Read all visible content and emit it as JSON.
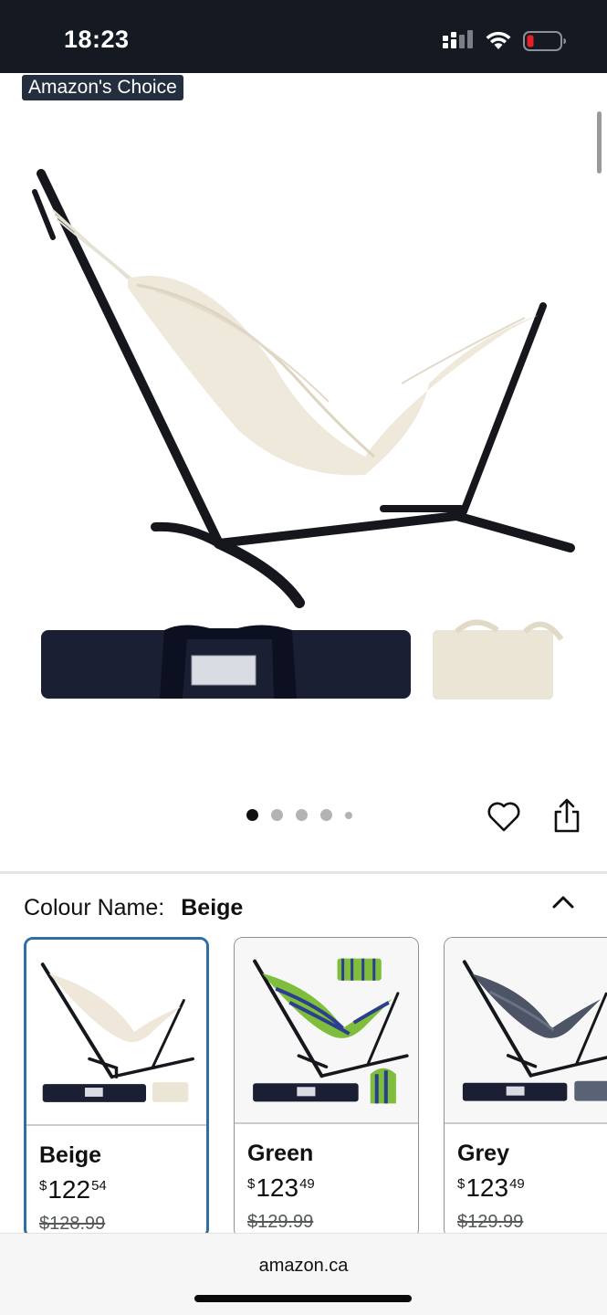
{
  "status_bar": {
    "time": "18:23"
  },
  "badge": {
    "label": "Amazon's Choice"
  },
  "carousel": {
    "total": 5,
    "active_index": 0
  },
  "colour_selector": {
    "label": "Colour Name:",
    "selected": "Beige",
    "options": [
      {
        "name": "Beige",
        "currency": "$",
        "price_whole": "122",
        "price_cents": "54",
        "list_price": "$128.99",
        "colors": {
          "fabric": "#efe8da",
          "stripe": "#efe8da"
        }
      },
      {
        "name": "Green",
        "currency": "$",
        "price_whole": "123",
        "price_cents": "49",
        "list_price": "$129.99",
        "colors": {
          "fabric": "#7fbd3c",
          "stripe": "#2c3f8f"
        }
      },
      {
        "name": "Grey",
        "currency": "$",
        "price_whole": "123",
        "price_cents": "49",
        "list_price": "$129.99",
        "colors": {
          "fabric": "#4d5466",
          "stripe": "#6b7285"
        }
      }
    ]
  },
  "browser": {
    "url": "amazon.ca"
  },
  "colors": {
    "status_bar_bg": "#151a22",
    "badge_bg": "#232f3e",
    "selected_border": "#2f6fa6",
    "battery_low": "#e5202a"
  },
  "icons": [
    "signal-icon",
    "wifi-icon",
    "battery-icon",
    "heart-icon",
    "share-icon",
    "chevron-up-icon"
  ]
}
